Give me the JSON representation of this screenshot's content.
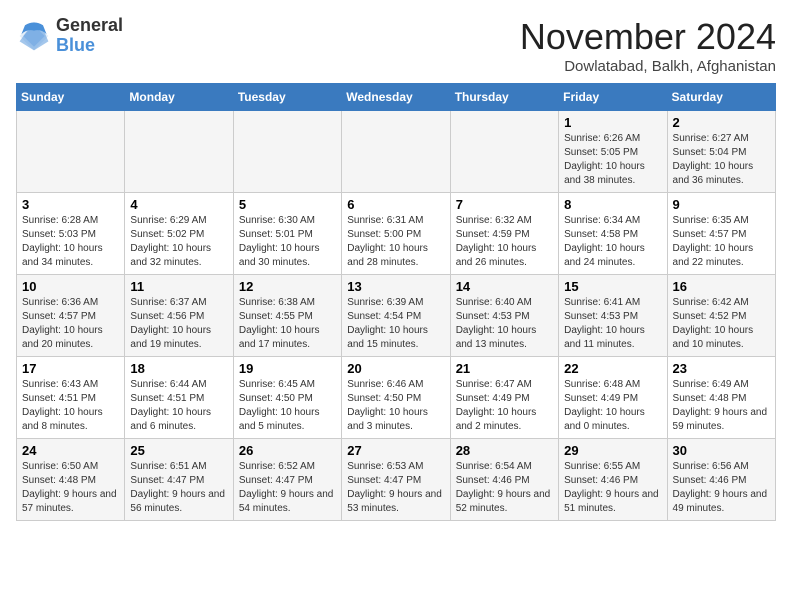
{
  "logo": {
    "general": "General",
    "blue": "Blue"
  },
  "title": "November 2024",
  "location": "Dowlatabad, Balkh, Afghanistan",
  "days_of_week": [
    "Sunday",
    "Monday",
    "Tuesday",
    "Wednesday",
    "Thursday",
    "Friday",
    "Saturday"
  ],
  "weeks": [
    [
      {
        "day": "",
        "info": ""
      },
      {
        "day": "",
        "info": ""
      },
      {
        "day": "",
        "info": ""
      },
      {
        "day": "",
        "info": ""
      },
      {
        "day": "",
        "info": ""
      },
      {
        "day": "1",
        "info": "Sunrise: 6:26 AM\nSunset: 5:05 PM\nDaylight: 10 hours and 38 minutes."
      },
      {
        "day": "2",
        "info": "Sunrise: 6:27 AM\nSunset: 5:04 PM\nDaylight: 10 hours and 36 minutes."
      }
    ],
    [
      {
        "day": "3",
        "info": "Sunrise: 6:28 AM\nSunset: 5:03 PM\nDaylight: 10 hours and 34 minutes."
      },
      {
        "day": "4",
        "info": "Sunrise: 6:29 AM\nSunset: 5:02 PM\nDaylight: 10 hours and 32 minutes."
      },
      {
        "day": "5",
        "info": "Sunrise: 6:30 AM\nSunset: 5:01 PM\nDaylight: 10 hours and 30 minutes."
      },
      {
        "day": "6",
        "info": "Sunrise: 6:31 AM\nSunset: 5:00 PM\nDaylight: 10 hours and 28 minutes."
      },
      {
        "day": "7",
        "info": "Sunrise: 6:32 AM\nSunset: 4:59 PM\nDaylight: 10 hours and 26 minutes."
      },
      {
        "day": "8",
        "info": "Sunrise: 6:34 AM\nSunset: 4:58 PM\nDaylight: 10 hours and 24 minutes."
      },
      {
        "day": "9",
        "info": "Sunrise: 6:35 AM\nSunset: 4:57 PM\nDaylight: 10 hours and 22 minutes."
      }
    ],
    [
      {
        "day": "10",
        "info": "Sunrise: 6:36 AM\nSunset: 4:57 PM\nDaylight: 10 hours and 20 minutes."
      },
      {
        "day": "11",
        "info": "Sunrise: 6:37 AM\nSunset: 4:56 PM\nDaylight: 10 hours and 19 minutes."
      },
      {
        "day": "12",
        "info": "Sunrise: 6:38 AM\nSunset: 4:55 PM\nDaylight: 10 hours and 17 minutes."
      },
      {
        "day": "13",
        "info": "Sunrise: 6:39 AM\nSunset: 4:54 PM\nDaylight: 10 hours and 15 minutes."
      },
      {
        "day": "14",
        "info": "Sunrise: 6:40 AM\nSunset: 4:53 PM\nDaylight: 10 hours and 13 minutes."
      },
      {
        "day": "15",
        "info": "Sunrise: 6:41 AM\nSunset: 4:53 PM\nDaylight: 10 hours and 11 minutes."
      },
      {
        "day": "16",
        "info": "Sunrise: 6:42 AM\nSunset: 4:52 PM\nDaylight: 10 hours and 10 minutes."
      }
    ],
    [
      {
        "day": "17",
        "info": "Sunrise: 6:43 AM\nSunset: 4:51 PM\nDaylight: 10 hours and 8 minutes."
      },
      {
        "day": "18",
        "info": "Sunrise: 6:44 AM\nSunset: 4:51 PM\nDaylight: 10 hours and 6 minutes."
      },
      {
        "day": "19",
        "info": "Sunrise: 6:45 AM\nSunset: 4:50 PM\nDaylight: 10 hours and 5 minutes."
      },
      {
        "day": "20",
        "info": "Sunrise: 6:46 AM\nSunset: 4:50 PM\nDaylight: 10 hours and 3 minutes."
      },
      {
        "day": "21",
        "info": "Sunrise: 6:47 AM\nSunset: 4:49 PM\nDaylight: 10 hours and 2 minutes."
      },
      {
        "day": "22",
        "info": "Sunrise: 6:48 AM\nSunset: 4:49 PM\nDaylight: 10 hours and 0 minutes."
      },
      {
        "day": "23",
        "info": "Sunrise: 6:49 AM\nSunset: 4:48 PM\nDaylight: 9 hours and 59 minutes."
      }
    ],
    [
      {
        "day": "24",
        "info": "Sunrise: 6:50 AM\nSunset: 4:48 PM\nDaylight: 9 hours and 57 minutes."
      },
      {
        "day": "25",
        "info": "Sunrise: 6:51 AM\nSunset: 4:47 PM\nDaylight: 9 hours and 56 minutes."
      },
      {
        "day": "26",
        "info": "Sunrise: 6:52 AM\nSunset: 4:47 PM\nDaylight: 9 hours and 54 minutes."
      },
      {
        "day": "27",
        "info": "Sunrise: 6:53 AM\nSunset: 4:47 PM\nDaylight: 9 hours and 53 minutes."
      },
      {
        "day": "28",
        "info": "Sunrise: 6:54 AM\nSunset: 4:46 PM\nDaylight: 9 hours and 52 minutes."
      },
      {
        "day": "29",
        "info": "Sunrise: 6:55 AM\nSunset: 4:46 PM\nDaylight: 9 hours and 51 minutes."
      },
      {
        "day": "30",
        "info": "Sunrise: 6:56 AM\nSunset: 4:46 PM\nDaylight: 9 hours and 49 minutes."
      }
    ]
  ]
}
